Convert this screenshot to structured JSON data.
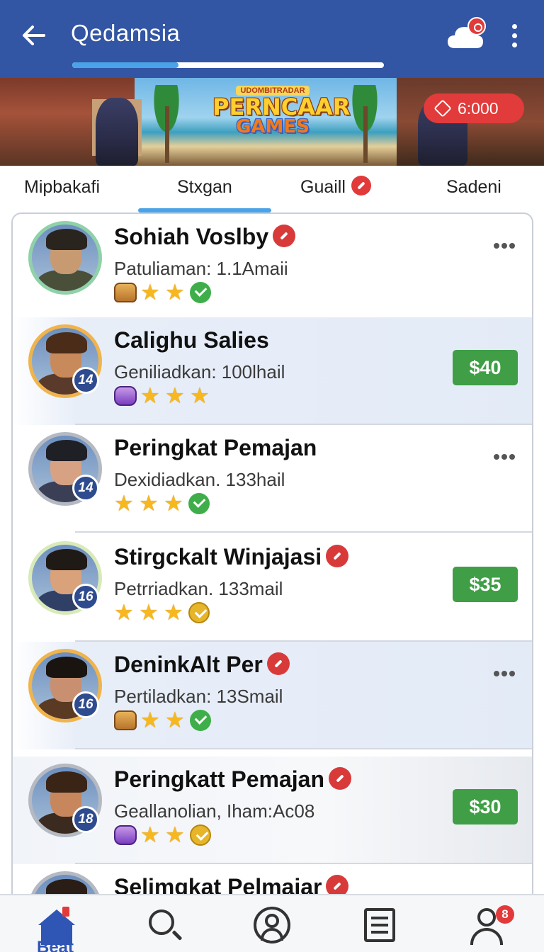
{
  "header": {
    "title": "Qedamsia",
    "progress": 0.34
  },
  "banner": {
    "logo_sub": "UDOMBITRADAR",
    "logo_main": "PERNCAAR",
    "logo_games": "GAMES",
    "coins": "6:000"
  },
  "tabs": [
    {
      "label": "Mipbakafi"
    },
    {
      "label": "Stxgan",
      "active": true
    },
    {
      "label": "Guaill",
      "badge": true
    },
    {
      "label": "Sadeni"
    }
  ],
  "players": [
    {
      "name": "Sohiah Voslby",
      "verified": true,
      "subtitle": "Patuliaman: 1.1Amaii",
      "level": "",
      "icons": [
        "chest-icon",
        "star-icon",
        "star-icon",
        "check-green-icon"
      ],
      "action": "more"
    },
    {
      "name": "Calighu Salies",
      "verified": false,
      "subtitle": "Geniliadkan: 100lhail",
      "level": "14",
      "icons": [
        "bag-icon",
        "star-icon",
        "star-icon",
        "star-icon"
      ],
      "action": "price",
      "price": "$40"
    },
    {
      "name": "Peringkat  Pemajan",
      "verified": false,
      "subtitle": "Dexidiadkan. 133hail",
      "level": "14",
      "icons": [
        "star-icon",
        "star-icon",
        "star-icon",
        "check-green-icon"
      ],
      "action": "more"
    },
    {
      "name": "Stirgckalt Winjajasi",
      "verified": true,
      "subtitle": "Petrriadkan. 133mail",
      "level": "16",
      "icons": [
        "star-icon",
        "star-icon",
        "star-icon",
        "check-gold-icon"
      ],
      "action": "price",
      "price": "$35"
    },
    {
      "name": "DeninkAlt Per",
      "verified": true,
      "subtitle": "Pertiladkan: 13Smail",
      "level": "16",
      "icons": [
        "chest-icon",
        "star-icon",
        "star-icon",
        "check-green-icon"
      ],
      "action": "more"
    },
    {
      "name": "Peringkatt Pemajan",
      "verified": true,
      "subtitle": "Geallanolian, Iham:Ac08",
      "level": "18",
      "icons": [
        "bag-icon",
        "star-icon",
        "star-icon",
        "check-gold-icon"
      ],
      "action": "price",
      "price": "$30"
    },
    {
      "name": "Selimgkat Pelmajar",
      "verified": true,
      "subtitle": "",
      "level": "",
      "icons": [],
      "action": ""
    }
  ],
  "bottom_nav": {
    "home_label": "Beat",
    "badge_count": "8"
  },
  "colors": {
    "header_bg": "#3255a4",
    "accent_blue": "#4aa3e8",
    "price_green": "#3f9e46",
    "badge_red": "#e23a3a"
  }
}
